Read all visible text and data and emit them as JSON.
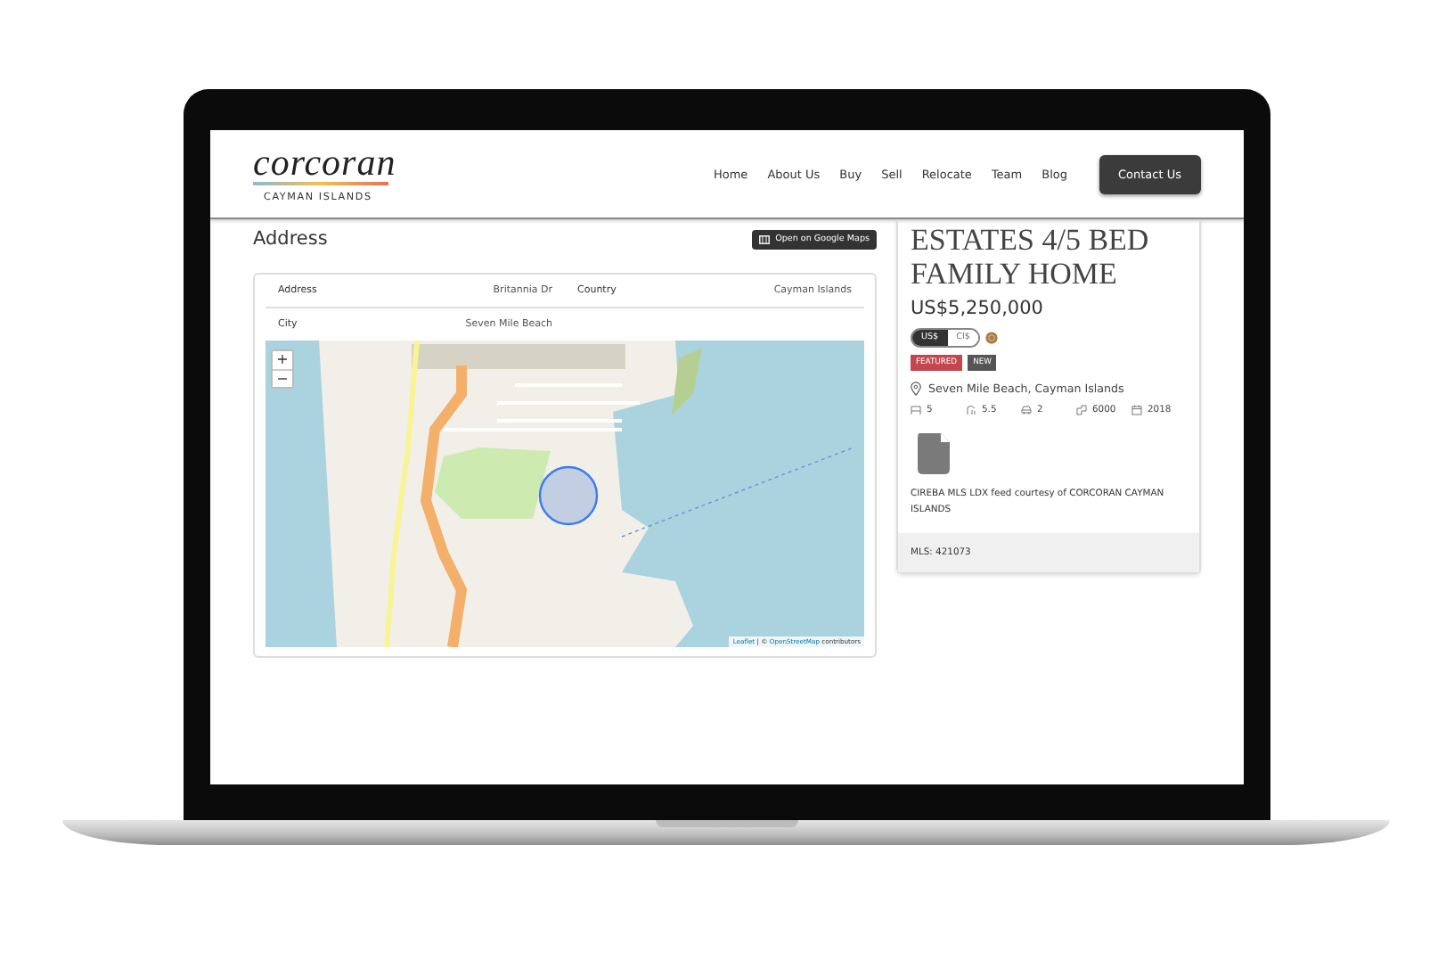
{
  "header": {
    "logo": {
      "wordmark": "corcoran",
      "subtitle": "CAYMAN ISLANDS"
    },
    "nav": [
      {
        "label": "Home"
      },
      {
        "label": "About Us"
      },
      {
        "label": "Buy"
      },
      {
        "label": "Sell"
      },
      {
        "label": "Relocate"
      },
      {
        "label": "Team"
      },
      {
        "label": "Blog"
      }
    ],
    "contact_button": "Contact Us"
  },
  "address_section": {
    "title": "Address",
    "map_button": "Open on Google Maps",
    "fields": [
      {
        "label": "Address",
        "value": "Britannia Dr"
      },
      {
        "label": "Country",
        "value": "Cayman Islands"
      },
      {
        "label": "City",
        "value": "Seven Mile Beach"
      }
    ],
    "map": {
      "zoom_in": "+",
      "zoom_out": "−",
      "attribution": [
        {
          "text": "Leaflet",
          "link": true
        },
        {
          "text": "| ©",
          "link": false
        },
        {
          "text": "OpenStreetMap",
          "link": true
        },
        {
          "text": "contributors",
          "link": false
        }
      ]
    }
  },
  "listing": {
    "title": "ESTATES 4/5 BED FAMILY HOME",
    "price": "US$5,250,000",
    "currencies": [
      {
        "label": "US$",
        "selected": true
      },
      {
        "label": "CI$",
        "selected": false
      }
    ],
    "badges": [
      {
        "label": "FEATURED",
        "color": "#c4474f"
      },
      {
        "label": "NEW",
        "color": "#555555"
      }
    ],
    "location": "Seven Mile Beach, Cayman Islands",
    "stats": [
      {
        "kind": "beds",
        "value": "5"
      },
      {
        "kind": "baths",
        "value": "5.5"
      },
      {
        "kind": "garage",
        "value": "2"
      },
      {
        "kind": "area",
        "value": "6000"
      },
      {
        "kind": "year",
        "value": "2018"
      }
    ],
    "courtesy": "CIREBA MLS LDX feed courtesy of CORCORAN CAYMAN ISLANDS",
    "mls": "MLS: 421073"
  }
}
